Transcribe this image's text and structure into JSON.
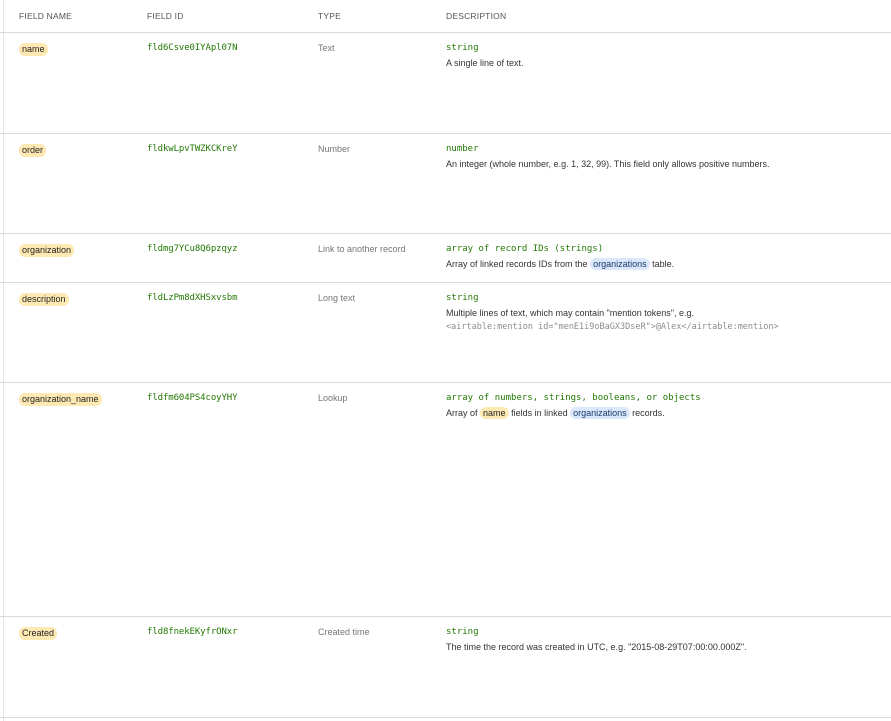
{
  "headers": {
    "field_name": "FIELD NAME",
    "field_id": "FIELD ID",
    "type": "TYPE",
    "description": "DESCRIPTION"
  },
  "rows": [
    {
      "name": "name",
      "id": "fld6Csve0IYApl07N",
      "type": "Text",
      "desc_type": "string",
      "desc_text": "A single line of text."
    },
    {
      "name": "order",
      "id": "fldkwLpvTWZKCKreY",
      "type": "Number",
      "desc_type": "number",
      "desc_text": "An integer (whole number, e.g. 1, 32, 99). This field only allows positive numbers."
    },
    {
      "name": "organization",
      "id": "fldmg7YCu8Q6pzqyz",
      "type": "Link to another record",
      "desc_type": "array of record IDs (strings)",
      "desc_pre": "Array of linked records IDs from the",
      "desc_table": "organizations",
      "desc_post": "table."
    },
    {
      "name": "description",
      "id": "fldLzPm8dXHSxvsbm",
      "type": "Long text",
      "desc_type": "string",
      "desc_text": "Multiple lines of text, which may contain \"mention tokens\", e.g.",
      "desc_code": "<airtable:mention id=\"menE1i9oBaGX3DseR\">@Alex</airtable:mention>"
    },
    {
      "name": "organization_name",
      "id": "fldfm604PS4coyYHY",
      "type": "Lookup",
      "desc_type": "array of numbers, strings, booleans, or objects",
      "desc_pre": "Array of",
      "desc_field": "name",
      "desc_mid": "fields in linked",
      "desc_table": "organizations",
      "desc_post": "records."
    },
    {
      "name": "Created",
      "id": "fld8fnekEKyfrONxr",
      "type": "Created time",
      "desc_type": "string",
      "desc_text": "The time the record was created in UTC, e.g. \"2015-08-29T07:00:00.000Z\"."
    }
  ]
}
